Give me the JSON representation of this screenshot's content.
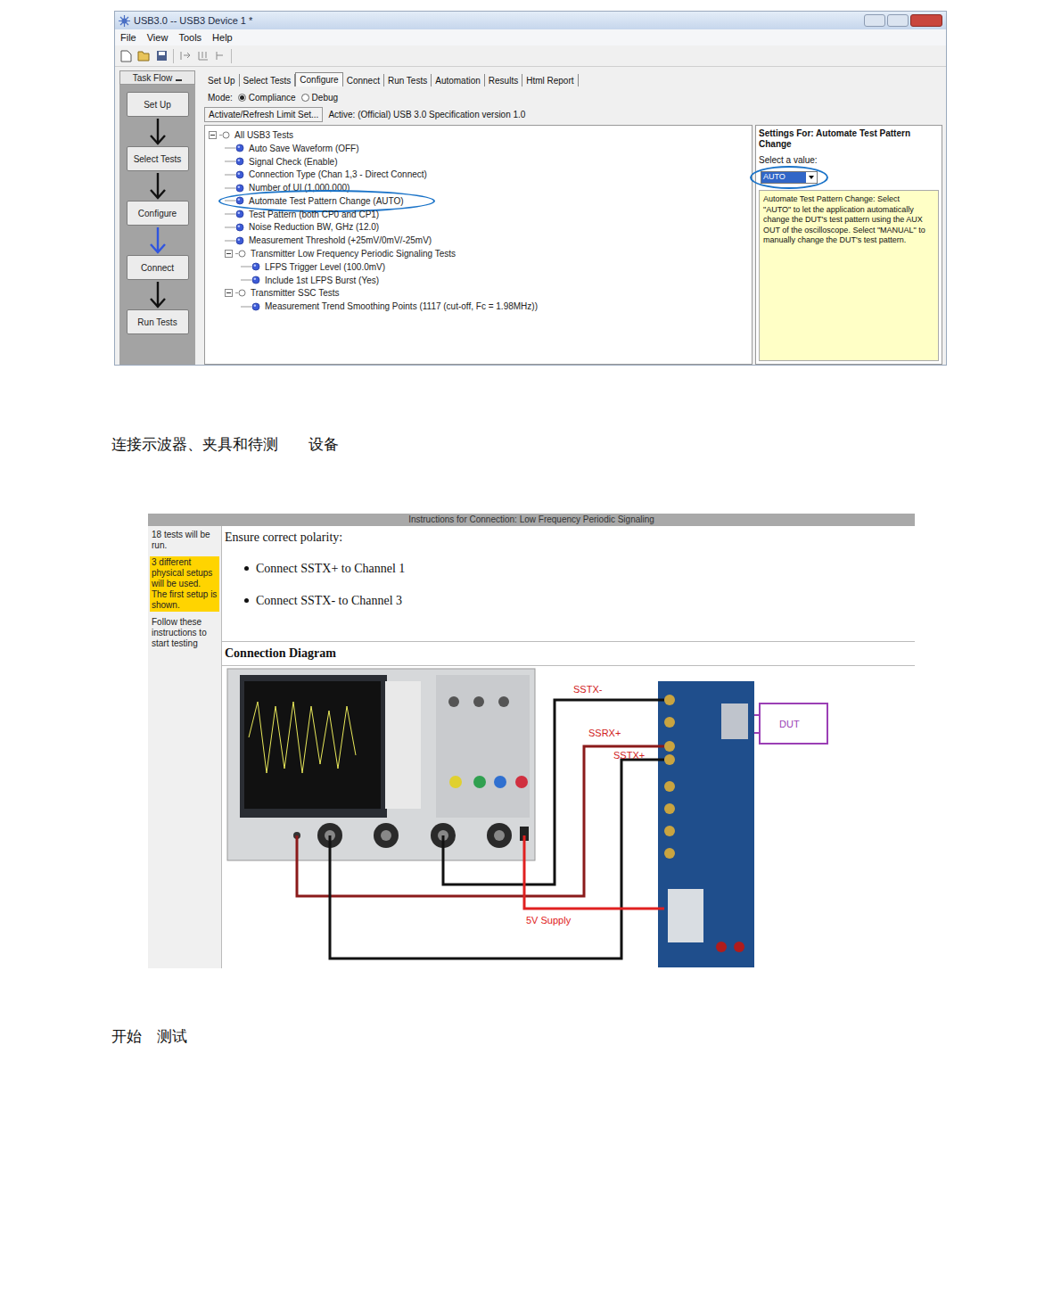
{
  "screenshot1": {
    "window": {
      "title": "USB3.0 -- USB3 Device 1 *"
    },
    "menu": [
      "File",
      "View",
      "Tools",
      "Help"
    ],
    "task_flow": {
      "title": "Task Flow",
      "steps": [
        {
          "label": "Set Up",
          "current": false
        },
        {
          "label": "Select Tests",
          "current": false
        },
        {
          "label": "Configure",
          "current": true
        },
        {
          "label": "Connect",
          "current": false
        },
        {
          "label": "Run Tests",
          "current": false
        }
      ]
    },
    "tabs": [
      {
        "label": "Set Up",
        "selected": false
      },
      {
        "label": "Select Tests",
        "selected": false
      },
      {
        "label": "Configure",
        "selected": true
      },
      {
        "label": "Connect",
        "selected": false
      },
      {
        "label": "Run Tests",
        "selected": false
      },
      {
        "label": "Automation",
        "selected": false
      },
      {
        "label": "Results",
        "selected": false
      },
      {
        "label": "Html Report",
        "selected": false
      }
    ],
    "mode": {
      "label": "Mode:",
      "options": [
        {
          "label": "Compliance",
          "selected": true
        },
        {
          "label": "Debug",
          "selected": false
        }
      ]
    },
    "limit_button": "Activate/Refresh Limit Set...",
    "active_limit": "Active: (Official) USB 3.0 Specification version 1.0",
    "tree": [
      {
        "label": "All USB3 Tests",
        "depth": 0,
        "kind": "group",
        "circled": false
      },
      {
        "label": "Auto Save Waveform (OFF)",
        "depth": 1,
        "kind": "item",
        "circled": false
      },
      {
        "label": "Signal Check (Enable)",
        "depth": 1,
        "kind": "item",
        "circled": false
      },
      {
        "label": "Connection Type (Chan 1,3 - Direct Connect)",
        "depth": 1,
        "kind": "item",
        "circled": false
      },
      {
        "label": "Number of UI (1,000,000)",
        "depth": 1,
        "kind": "item",
        "circled": false
      },
      {
        "label": "Automate Test Pattern Change (AUTO)",
        "depth": 1,
        "kind": "item",
        "circled": true
      },
      {
        "label": "Test Pattern (both CP0 and CP1)",
        "depth": 1,
        "kind": "item",
        "circled": false
      },
      {
        "label": "Noise Reduction BW, GHz (12.0)",
        "depth": 1,
        "kind": "item",
        "circled": false
      },
      {
        "label": "Measurement Threshold (+25mV/0mV/-25mV)",
        "depth": 1,
        "kind": "item",
        "circled": false
      },
      {
        "label": "Transmitter Low Frequency Periodic Signaling Tests",
        "depth": 1,
        "kind": "group",
        "circled": false
      },
      {
        "label": "LFPS Trigger Level (100.0mV)",
        "depth": 2,
        "kind": "item",
        "circled": false
      },
      {
        "label": "Include 1st LFPS Burst (Yes)",
        "depth": 2,
        "kind": "item",
        "circled": false
      },
      {
        "label": "Transmitter SSC Tests",
        "depth": 1,
        "kind": "group",
        "circled": false
      },
      {
        "label": "Measurement Trend Smoothing Points (1117 (cut-off, Fc = 1.98MHz))",
        "depth": 2,
        "kind": "item",
        "circled": false
      }
    ],
    "settings": {
      "title": "Settings For: Automate Test Pattern Change",
      "prompt": "Select a value:",
      "value": "AUTO",
      "circled": true,
      "description": "Automate Test Pattern Change: Select \"AUTO\" to let the application automatically change the DUT's test pattern using the AUX OUT of the oscilloscope. Select \"MANUAL\" to manually change the DUT's test pattern."
    }
  },
  "caption1": "连接示波器、夹具和待测　　设备",
  "screenshot2": {
    "header": "Instructions for Connection: Low Frequency Periodic Signaling",
    "sidebar": [
      {
        "text": "18 tests will be run.",
        "highlighted": false
      },
      {
        "text": "3 different physical setups will be used. The first setup is shown.",
        "highlighted": true
      },
      {
        "text": "Follow these instructions to start testing",
        "highlighted": false
      }
    ],
    "intro": "Ensure correct polarity:",
    "bullets": [
      "Connect SSTX+ to Channel 1",
      "Connect SSTX- to Channel 3"
    ],
    "diagram_title": "Connection Diagram",
    "dut": "DUT",
    "wires": [
      {
        "label": "SSTX-",
        "color": "#111111"
      },
      {
        "label": "SSRX+",
        "color": "#8b1a1a"
      },
      {
        "label": "SSTX+",
        "color": "#111111"
      },
      {
        "label": "5V Supply",
        "color": "#e02020"
      }
    ]
  },
  "caption2": "开始　测试"
}
